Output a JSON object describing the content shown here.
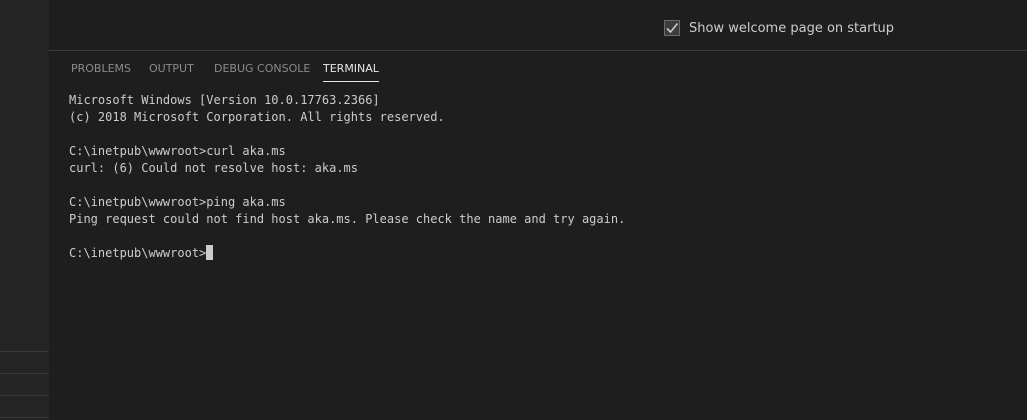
{
  "welcome": {
    "startup_checkbox_label": "Show welcome page on startup",
    "startup_checkbox_checked": true
  },
  "panel": {
    "tabs": [
      {
        "label": "PROBLEMS",
        "active": false
      },
      {
        "label": "OUTPUT",
        "active": false
      },
      {
        "label": "DEBUG CONSOLE",
        "active": false
      },
      {
        "label": "TERMINAL",
        "active": true
      }
    ]
  },
  "terminal": {
    "lines": [
      "Microsoft Windows [Version 10.0.17763.2366]",
      "(c) 2018 Microsoft Corporation. All rights reserved.",
      "",
      "C:\\inetpub\\wwwroot>curl aka.ms",
      "curl: (6) Could not resolve host: aka.ms",
      "",
      "C:\\inetpub\\wwwroot>ping aka.ms",
      "Ping request could not find host aka.ms. Please check the name and try again.",
      ""
    ],
    "prompt": "C:\\inetpub\\wwwroot>"
  },
  "colors": {
    "background": "#1e1e1e",
    "sidebar": "#252526",
    "text": "#cccccc",
    "tab_inactive": "#8b8b8b",
    "tab_active": "#e7e7e7"
  }
}
